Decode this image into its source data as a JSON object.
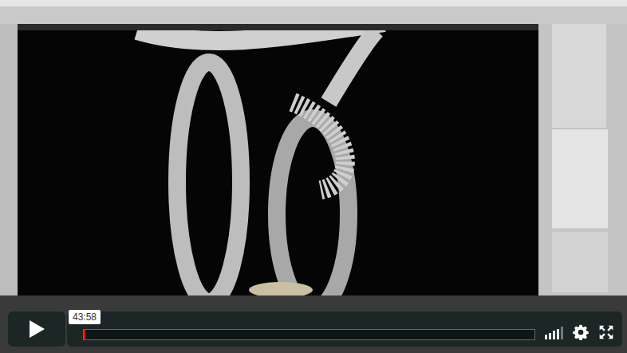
{
  "player": {
    "time": "43:58",
    "playing": false,
    "progress": {
      "level": 0.004
    },
    "volume": {
      "level": 0.8
    }
  }
}
